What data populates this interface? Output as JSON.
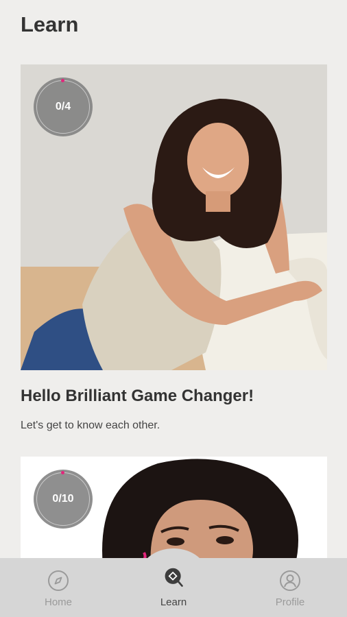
{
  "header": {
    "title": "Learn"
  },
  "cards": [
    {
      "progress": "0/4",
      "title": "Hello Brilliant Game Changer!",
      "subtitle": "Let's get to know each other."
    },
    {
      "progress": "0/10"
    }
  ],
  "nav": {
    "items": [
      {
        "label": "Home",
        "icon": "compass-icon",
        "active": false
      },
      {
        "label": "Learn",
        "icon": "learn-search-icon",
        "active": true
      },
      {
        "label": "Profile",
        "icon": "person-icon",
        "active": false
      }
    ]
  },
  "colors": {
    "background": "#efeeec",
    "nav_background": "#d6d6d6",
    "accent": "#e2257b",
    "badge": "#808080"
  }
}
